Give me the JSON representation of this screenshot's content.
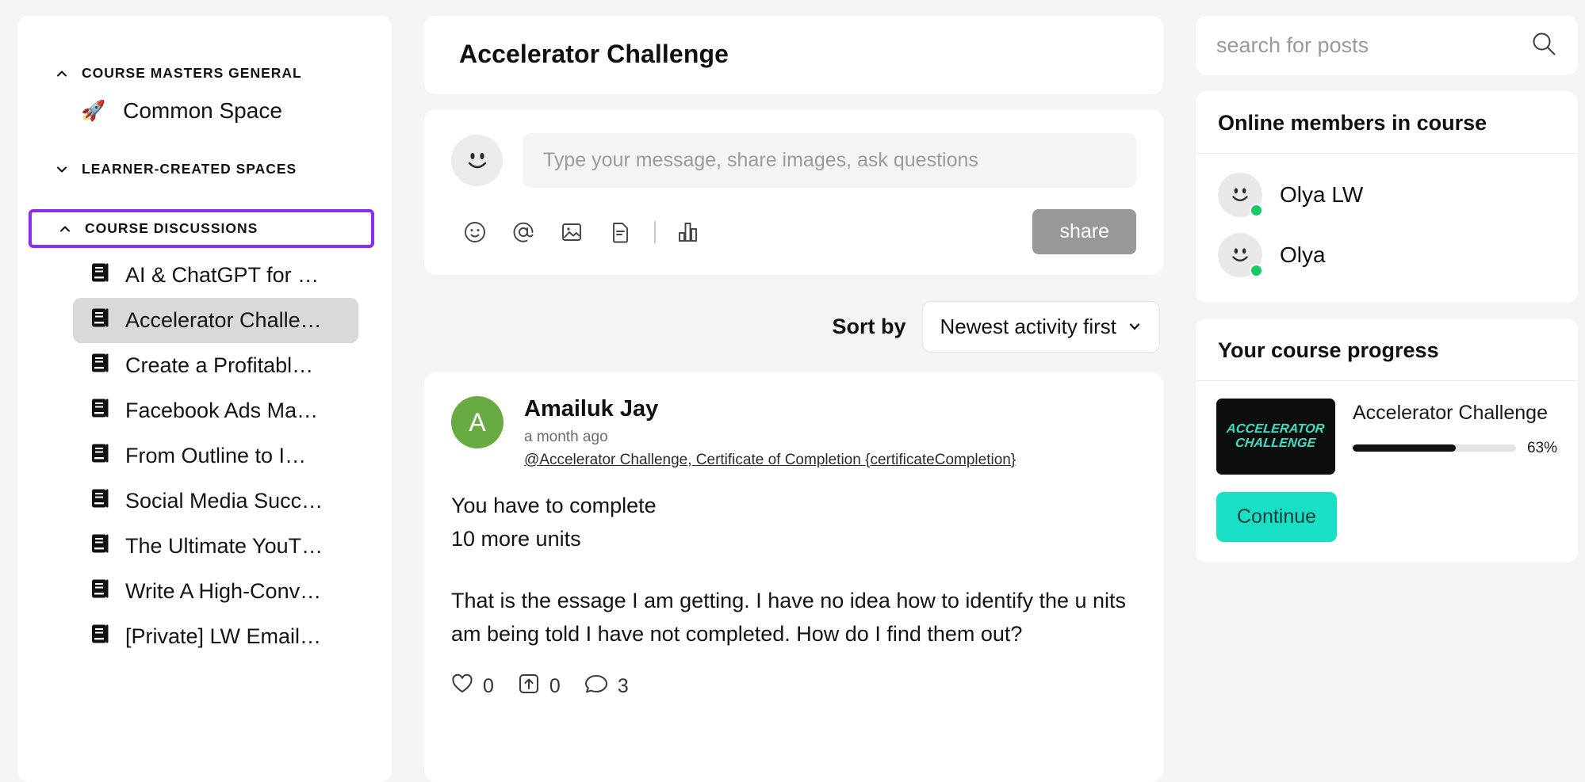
{
  "sidebar": {
    "sections": [
      {
        "id": "course-masters-general",
        "title": "COURSE MASTERS GENERAL",
        "caret": "chevron-up-icon",
        "highlighted": false,
        "spaces": [
          {
            "emoji": "🚀",
            "label": "Common Space"
          }
        ]
      },
      {
        "id": "learner-created-spaces",
        "title": "LEARNER-CREATED SPACES",
        "caret": "chevron-down-icon",
        "highlighted": false,
        "spaces": []
      },
      {
        "id": "course-discussions",
        "title": "COURSE DISCUSSIONS",
        "caret": "chevron-up-icon",
        "highlighted": true,
        "spaces": []
      }
    ],
    "discussions": [
      {
        "label": "AI & ChatGPT for …",
        "active": false
      },
      {
        "label": "Accelerator Challe…",
        "active": true
      },
      {
        "label": "Create a Profitabl…",
        "active": false
      },
      {
        "label": "Facebook Ads Ma…",
        "active": false
      },
      {
        "label": "From Outline to I…",
        "active": false
      },
      {
        "label": "Social Media Succ…",
        "active": false
      },
      {
        "label": "The Ultimate YouT…",
        "active": false
      },
      {
        "label": "Write A High-Conv…",
        "active": false
      },
      {
        "label": "[Private] LW Email…",
        "active": false
      }
    ]
  },
  "main": {
    "page_title": "Accelerator Challenge",
    "composer": {
      "avatar_icon": "smiley-avatar-icon",
      "placeholder": "Type your message, share images, ask questions",
      "value": "",
      "tools": [
        {
          "name": "emoji-icon"
        },
        {
          "name": "mention-icon"
        },
        {
          "name": "image-icon"
        },
        {
          "name": "document-icon"
        },
        {
          "name": "poll-icon"
        }
      ],
      "share_label": "share"
    },
    "sort": {
      "label": "Sort by",
      "selected": "Newest activity first",
      "caret": "chevron-down-icon"
    },
    "post": {
      "avatar_initial": "A",
      "author": "Amailuk Jay",
      "time": "a month ago",
      "tags": "@Accelerator Challenge, Certificate of Completion {certificateCompletion}",
      "body_line_1": "You have to complete",
      "body_line_2": "10 more units",
      "body_paragraph": "That is the essage I am getting. I have no idea how to identify the u nits am being told I have not completed. How do I find them out?",
      "reactions": {
        "like_icon": "heart-icon",
        "like_count": "0",
        "share_icon": "share-up-icon",
        "share_count": "0",
        "comment_icon": "comment-icon",
        "comment_count": "3"
      }
    }
  },
  "right": {
    "search": {
      "placeholder": "search for posts",
      "value": "",
      "icon": "search-icon"
    },
    "online_panel": {
      "title": "Online members in course",
      "members": [
        {
          "name": "Olya LW",
          "status": "online"
        },
        {
          "name": "Olya",
          "status": "online"
        }
      ]
    },
    "progress_panel": {
      "title": "Your course progress",
      "thumb_line_1": "ACCELERATOR",
      "thumb_line_2": "CHALLENGE",
      "course_name": "Accelerator Challenge",
      "percent_label": "63%",
      "percent_value": 63,
      "continue_label": "Continue"
    }
  },
  "colors": {
    "highlight_purple": "#8b2cf5",
    "accent_teal": "#18dfc6",
    "online_green": "#17c964",
    "avatar_green": "#69ab43"
  }
}
